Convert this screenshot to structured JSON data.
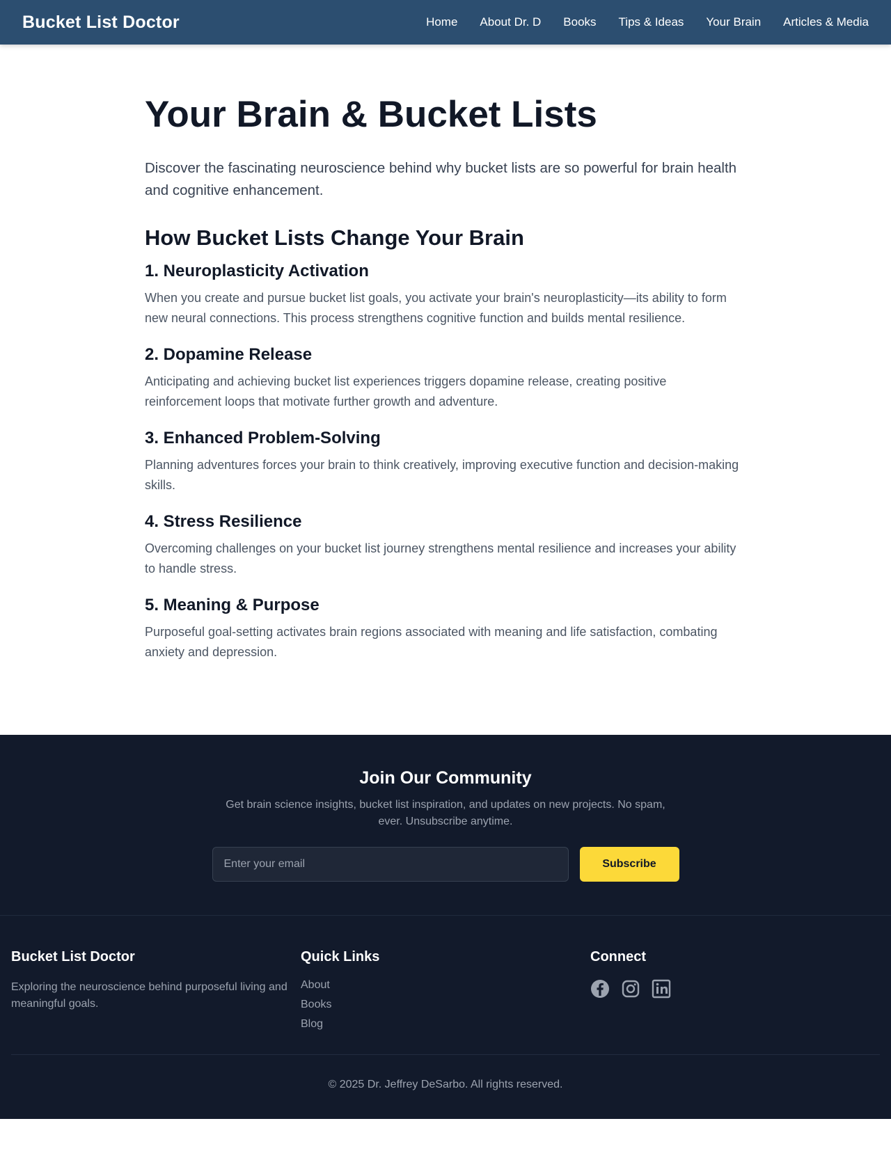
{
  "nav": {
    "brand": "Bucket List Doctor",
    "links": [
      "Home",
      "About Dr. D",
      "Books",
      "Tips & Ideas",
      "Your Brain",
      "Articles & Media"
    ]
  },
  "main": {
    "title": "Your Brain & Bucket Lists",
    "lead": "Discover the fascinating neuroscience behind why bucket lists are so powerful for brain health and cognitive enhancement.",
    "section_title": "How Bucket Lists Change Your Brain",
    "points": [
      {
        "title": "1. Neuroplasticity Activation",
        "text": "When you create and pursue bucket list goals, you activate your brain's neuroplasticity—its ability to form new neural connections. This process strengthens cognitive function and builds mental resilience."
      },
      {
        "title": "2. Dopamine Release",
        "text": "Anticipating and achieving bucket list experiences triggers dopamine release, creating positive reinforcement loops that motivate further growth and adventure."
      },
      {
        "title": "3. Enhanced Problem-Solving",
        "text": "Planning adventures forces your brain to think creatively, improving executive function and decision-making skills."
      },
      {
        "title": "4. Stress Resilience",
        "text": "Overcoming challenges on your bucket list journey strengthens mental resilience and increases your ability to handle stress."
      },
      {
        "title": "5. Meaning & Purpose",
        "text": "Purposeful goal-setting activates brain regions associated with meaning and life satisfaction, combating anxiety and depression."
      }
    ]
  },
  "newsletter": {
    "title": "Join Our Community",
    "text": "Get brain science insights, bucket list inspiration, and updates on new projects. No spam, ever. Unsubscribe anytime.",
    "email_placeholder": "Enter your email",
    "button_label": "Subscribe"
  },
  "footer": {
    "about_title": "Bucket List Doctor",
    "about_text": "Exploring the neuroscience behind purposeful living and meaningful goals.",
    "links_title": "Quick Links",
    "links": [
      "About",
      "Books",
      "Blog"
    ],
    "connect_title": "Connect",
    "social_icons": [
      "facebook-icon",
      "instagram-icon",
      "linkedin-icon"
    ],
    "copyright": "© 2025 Dr. Jeffrey DeSarbo. All rights reserved."
  },
  "colors": {
    "nav_bg": "#2c4e70",
    "footer_bg": "#121a2b",
    "accent": "#fcd939"
  }
}
